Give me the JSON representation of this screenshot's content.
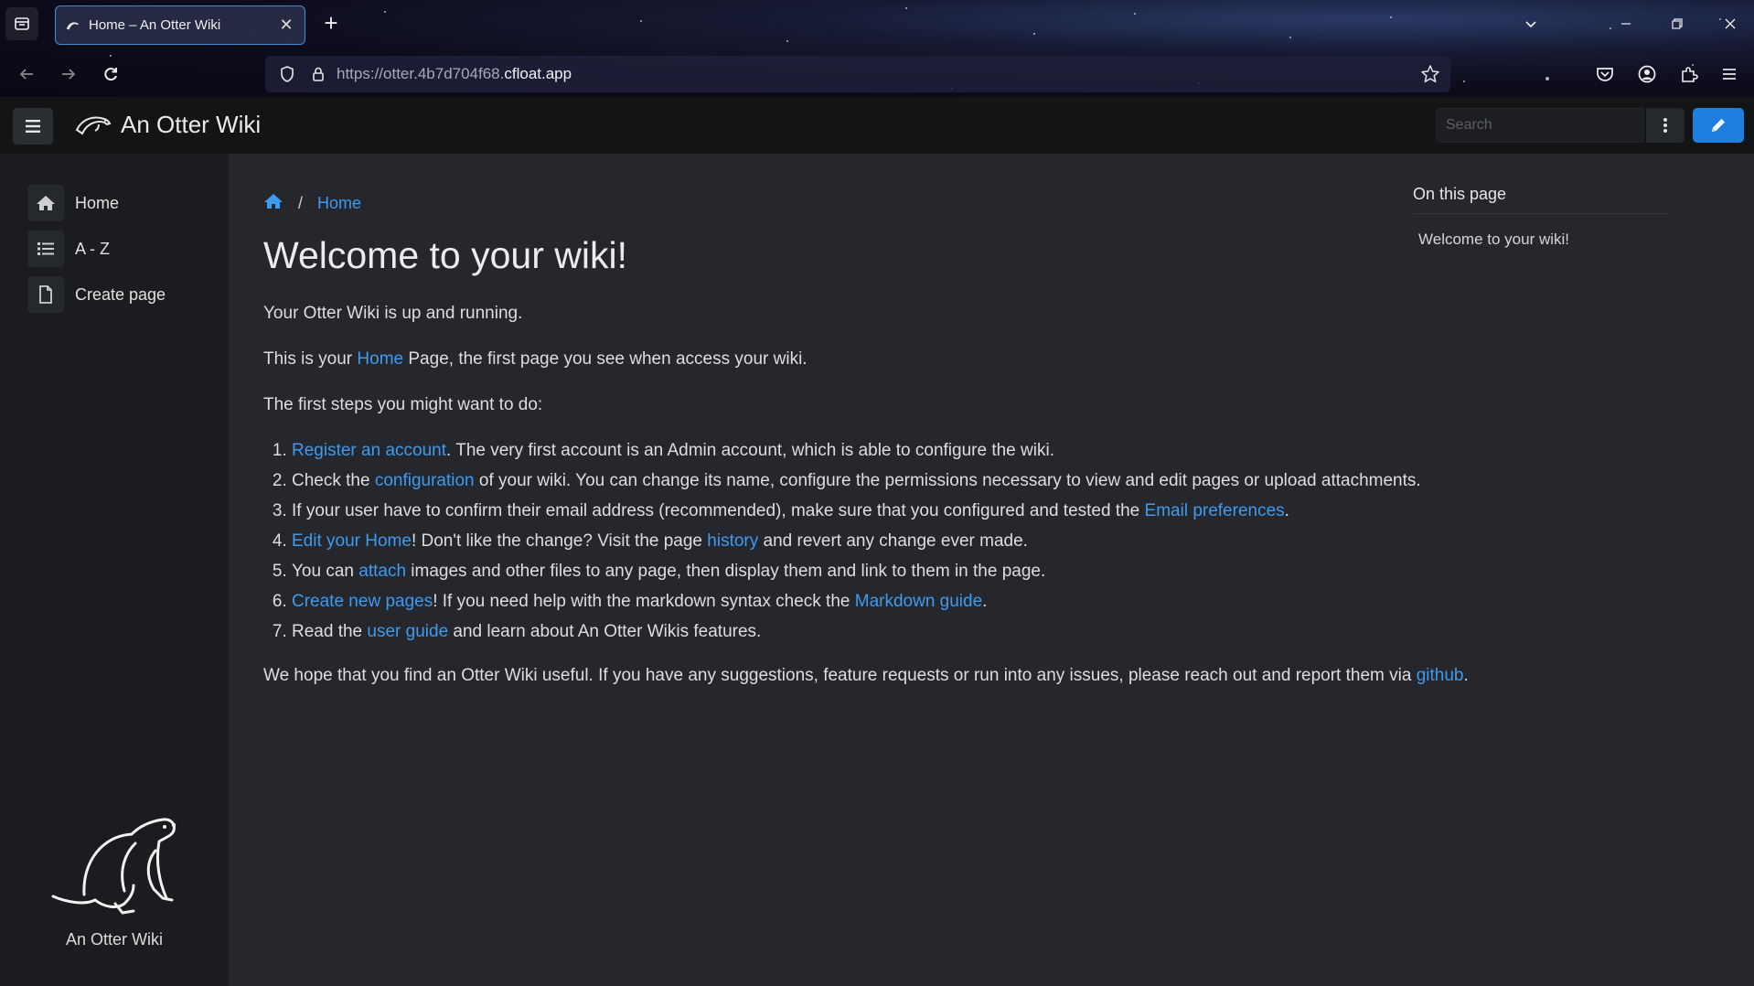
{
  "browser": {
    "tab_title": "Home – An Otter Wiki",
    "url_prefix": "https://otter.4b7d704f68.",
    "url_host": "cfloat.app"
  },
  "header": {
    "brand": "An Otter Wiki",
    "search_placeholder": "Search"
  },
  "sidebar": {
    "items": [
      {
        "label": "Home",
        "icon": "home-icon"
      },
      {
        "label": "A - Z",
        "icon": "list-icon"
      },
      {
        "label": "Create page",
        "icon": "file-icon"
      }
    ],
    "footer": "An Otter Wiki"
  },
  "breadcrumb": {
    "separator": "/",
    "current": "Home"
  },
  "page": {
    "title": "Welcome to your wiki!",
    "p1": "Your Otter Wiki is up and running.",
    "p2": {
      "a": "This is your ",
      "link": "Home",
      "b": " Page, the first page you see when access your wiki."
    },
    "p3": "The first steps you might want to do:",
    "steps": [
      {
        "link": "Register an account",
        "after": ". The very first account is an Admin account, which is able to configure the wiki."
      },
      {
        "before": "Check the ",
        "link": "configuration",
        "after": " of your wiki. You can change its name, configure the permissions necessary to view and edit pages or upload attachments."
      },
      {
        "before": "If your user have to confirm their email address (recommended), make sure that you configured and tested the ",
        "link": "Email preferences",
        "after": "."
      },
      {
        "link": "Edit your Home",
        "mid": "! Don't like the change? Visit the page ",
        "link2": "history",
        "after": " and revert any change ever made."
      },
      {
        "before": "You can ",
        "link": "attach",
        "after": " images and other files to any page, then display them and link to them in the page."
      },
      {
        "link": "Create new pages",
        "mid": "! If you need help with the markdown syntax check the ",
        "link2": "Markdown guide",
        "after": "."
      },
      {
        "before": "Read the ",
        "link": "user guide",
        "after": " and learn about An Otter Wikis features."
      }
    ],
    "p4": {
      "a": "We hope that you find an Otter Wiki useful. If you have any suggestions, feature requests or run into any issues, please reach out and report them via ",
      "link": "github",
      "b": "."
    }
  },
  "toc": {
    "title": "On this page",
    "items": [
      "Welcome to your wiki!"
    ]
  },
  "colors": {
    "accent": "#3d9bf0",
    "edit_button": "#1e7fe0",
    "sidebar_bg": "#1a1c1f",
    "main_bg": "#25272c"
  }
}
